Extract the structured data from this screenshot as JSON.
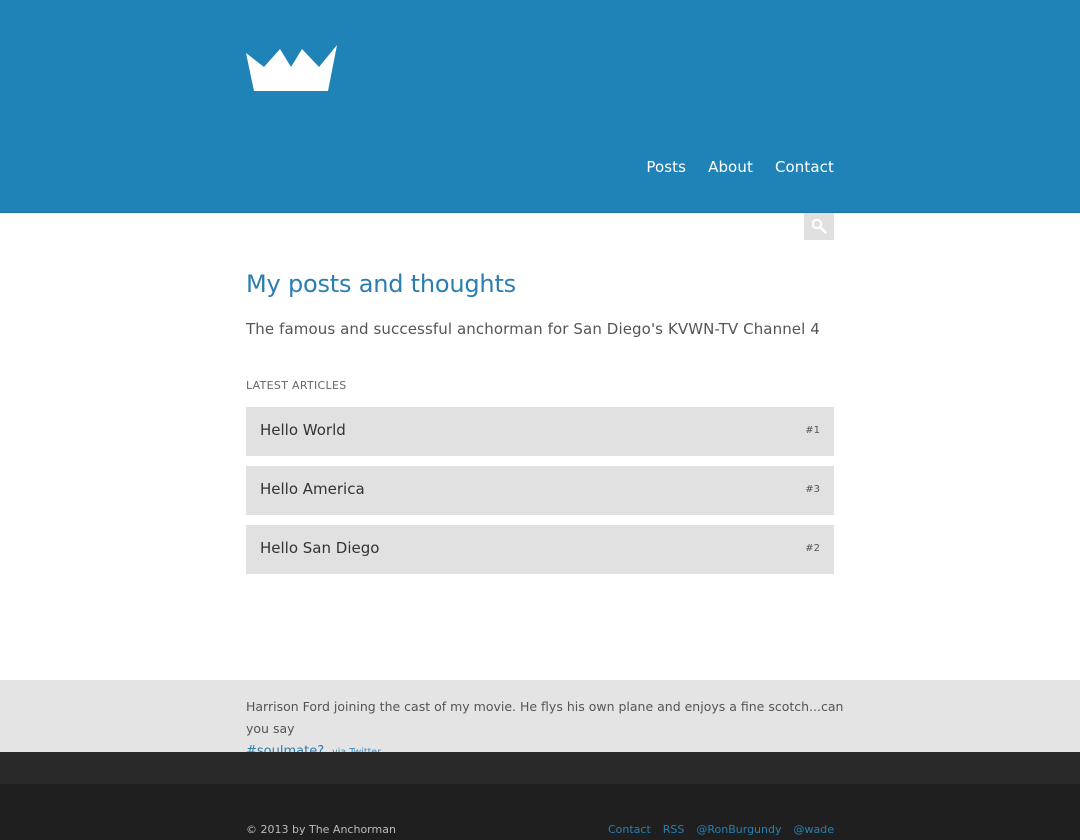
{
  "brand": {
    "logo_icon": "crown-icon",
    "header_color": "#1f83b8"
  },
  "nav": {
    "items": [
      {
        "label": "Posts"
      },
      {
        "label": "About"
      },
      {
        "label": "Contact"
      }
    ]
  },
  "search": {
    "icon": "search-icon"
  },
  "main": {
    "title": "My posts and thoughts",
    "subtitle": "The famous and successful anchorman for San Diego's KVWN-TV Channel 4",
    "section_label": "LATEST ARTICLES",
    "articles": [
      {
        "title": "Hello World",
        "number": "#1"
      },
      {
        "title": "Hello America",
        "number": "#3"
      },
      {
        "title": "Hello San Diego",
        "number": "#2"
      }
    ]
  },
  "tweet": {
    "text": "Harrison Ford joining the cast of my movie. He flys his own plane and enjoys a fine scotch...can you say",
    "hashtag": "#soulmate?",
    "via": "via Twitter"
  },
  "footer": {
    "copyright": "© 2013 by The Anchorman",
    "links": [
      {
        "label": "Contact"
      },
      {
        "label": "RSS"
      },
      {
        "label": "@RonBurgundy"
      },
      {
        "label": "@wade"
      }
    ]
  }
}
